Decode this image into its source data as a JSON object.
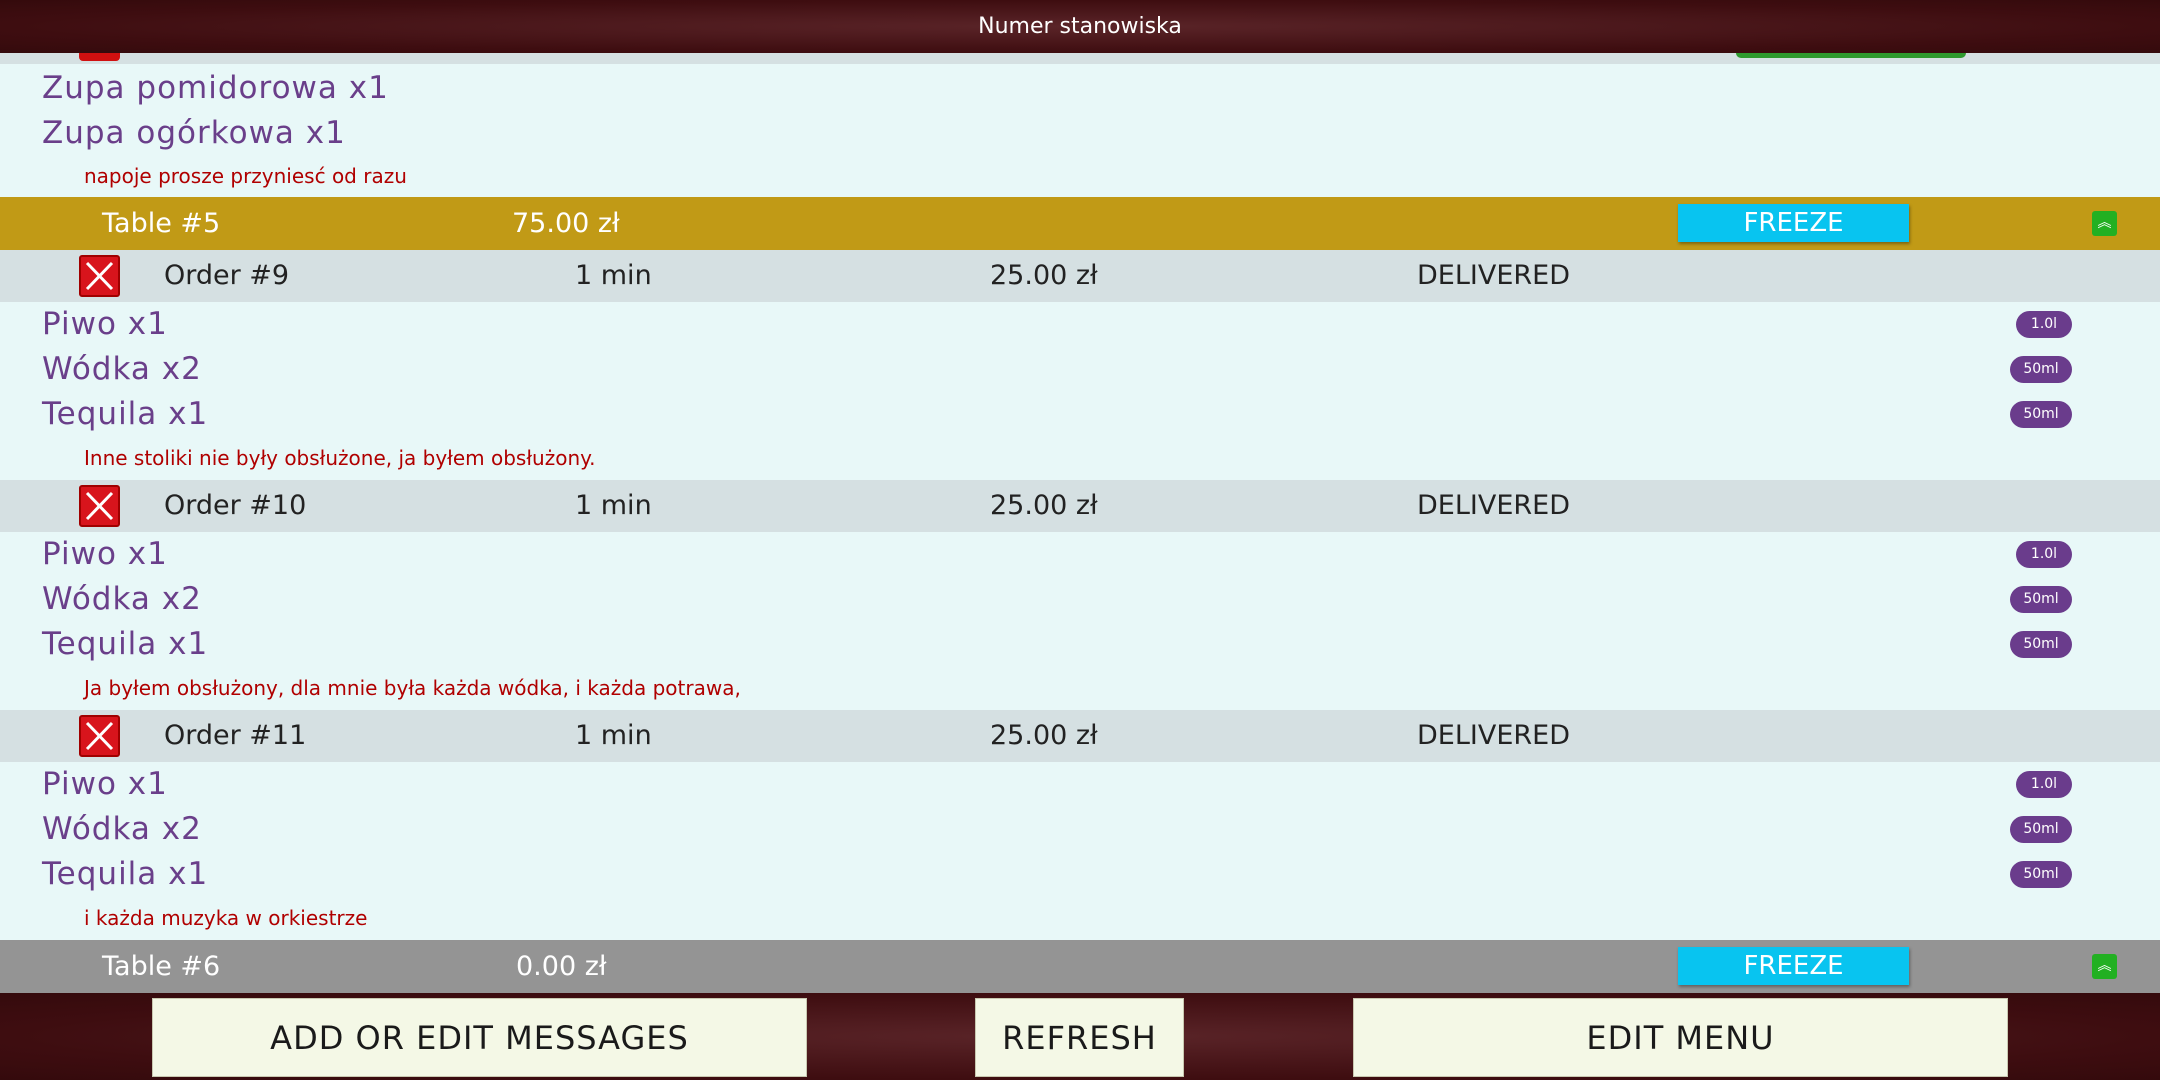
{
  "header": {
    "title": "Numer stanowiska"
  },
  "top_items": [
    {
      "label": "Zupa pomidorowa x1"
    },
    {
      "label": "Zupa ogórkowa x1"
    }
  ],
  "top_note": "napoje prosze przyniesć od razu",
  "tables": [
    {
      "name": "Table #5",
      "total": "75.00 zł",
      "freeze_label": "FREEZE",
      "color": "#c19a16"
    },
    {
      "name": "Table #6",
      "total": "0.00 zł",
      "freeze_label": "FREEZE",
      "color": "#949494"
    }
  ],
  "orders": [
    {
      "number": "Order #9",
      "time": "1 min",
      "price": "25.00 zł",
      "status": "DELIVERED",
      "items": [
        {
          "label": "Piwo x1",
          "size": "1.0l"
        },
        {
          "label": "Wódka x2",
          "size": "50ml"
        },
        {
          "label": "Tequila x1",
          "size": "50ml"
        }
      ],
      "note": "Inne stoliki nie były obsłużone, ja byłem obsłużony."
    },
    {
      "number": "Order #10",
      "time": "1 min",
      "price": "25.00 zł",
      "status": "DELIVERED",
      "items": [
        {
          "label": "Piwo x1",
          "size": "1.0l"
        },
        {
          "label": "Wódka x2",
          "size": "50ml"
        },
        {
          "label": "Tequila x1",
          "size": "50ml"
        }
      ],
      "note": "Ja byłem obsłużony, dla mnie była każda wódka, i każda potrawa,"
    },
    {
      "number": "Order #11",
      "time": "1 min",
      "price": "25.00 zł",
      "status": "DELIVERED",
      "items": [
        {
          "label": "Piwo x1",
          "size": "1.0l"
        },
        {
          "label": "Wódka x2",
          "size": "50ml"
        },
        {
          "label": "Tequila x1",
          "size": "50ml"
        }
      ],
      "note": "i każda muzyka w orkiestrze"
    }
  ],
  "footer": {
    "messages_label": "ADD OR EDIT MESSAGES",
    "refresh_label": "REFRESH",
    "menu_label": "EDIT MENU"
  }
}
